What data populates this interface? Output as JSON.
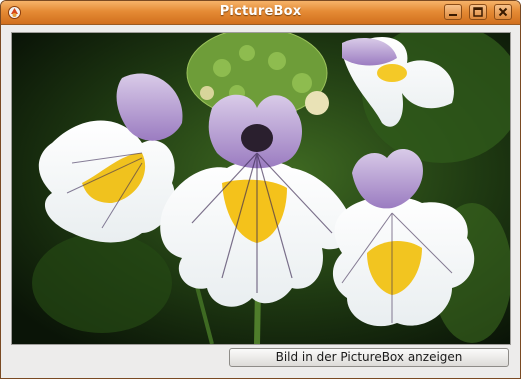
{
  "window": {
    "title": "PictureBox",
    "controls": {
      "minimize_icon": "minimize-icon",
      "maximize_icon": "maximize-icon",
      "close_icon": "close-icon"
    }
  },
  "picturebox": {
    "image_icon": "flower-photo"
  },
  "action_button": {
    "label": "Bild in der PictureBox anzeigen"
  },
  "colors": {
    "titlebar": "#e58b35",
    "window_bg": "#edeceb"
  }
}
